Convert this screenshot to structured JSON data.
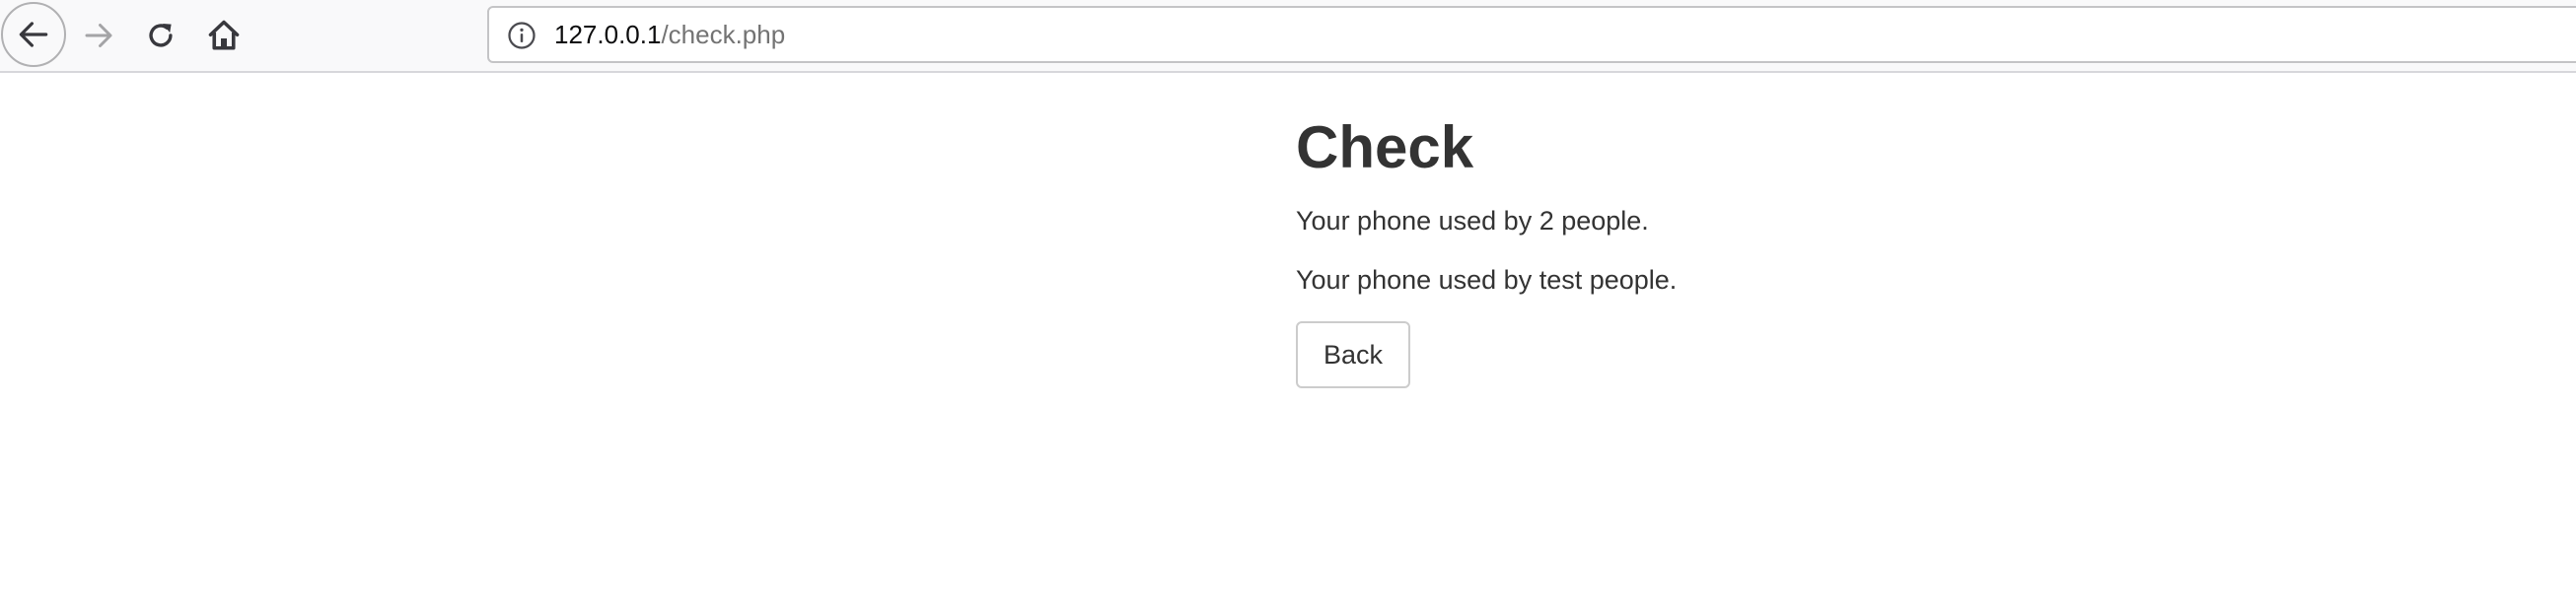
{
  "browser": {
    "url_host": "127.0.0.1",
    "url_path": "/check.php",
    "icons": {
      "back": "arrow-left-icon",
      "forward": "arrow-right-icon",
      "reload": "reload-icon",
      "home": "home-icon",
      "info": "info-icon"
    },
    "colors": {
      "toolbar_bg": "#f9f9fa",
      "url_host": "#0c0c0d",
      "url_path": "#737373"
    }
  },
  "page": {
    "title": "Check",
    "messages": [
      "Your phone used by 2 people.",
      "Your phone used by test people."
    ],
    "back_label": "Back",
    "colors": {
      "text": "#333333",
      "button_border": "#cccccc"
    }
  }
}
